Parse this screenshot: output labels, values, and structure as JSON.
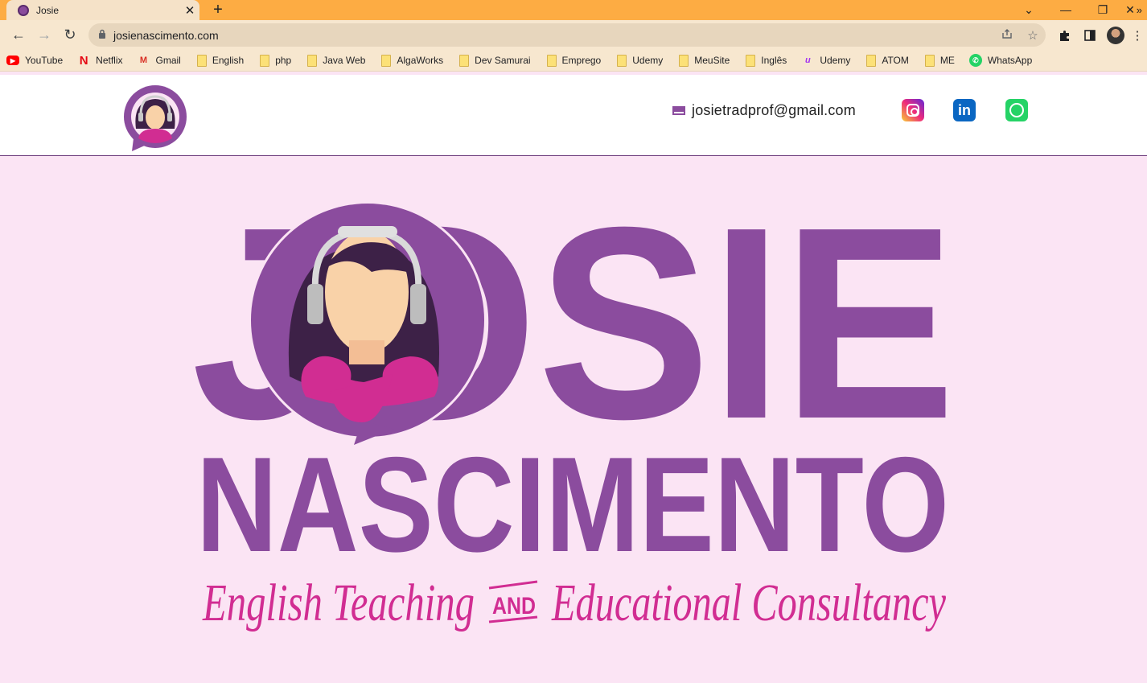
{
  "browser": {
    "tab": {
      "title": "Josie",
      "close_glyph": "✕"
    },
    "new_tab_glyph": "+",
    "window_controls": [
      "⌄",
      "—",
      "❐",
      "✕"
    ],
    "nav": {
      "back": "←",
      "forward": "→",
      "reload": "↻"
    },
    "url": "josienascimento.com",
    "omnibox_icons": [
      "share-icon",
      "star-icon"
    ],
    "toolbar_icons": [
      "extensions-icon",
      "sidepanel-icon",
      "profile-avatar",
      "menu-icon"
    ],
    "bookmarks": [
      {
        "label": "YouTube",
        "icon": "youtube"
      },
      {
        "label": "Netflix",
        "icon": "netflix"
      },
      {
        "label": "Gmail",
        "icon": "gmail"
      },
      {
        "label": "English",
        "icon": "folder"
      },
      {
        "label": "php",
        "icon": "folder"
      },
      {
        "label": "Java Web",
        "icon": "folder"
      },
      {
        "label": "AlgaWorks",
        "icon": "folder"
      },
      {
        "label": "Dev Samurai",
        "icon": "folder"
      },
      {
        "label": "Emprego",
        "icon": "folder"
      },
      {
        "label": "Udemy",
        "icon": "folder"
      },
      {
        "label": "MeuSite",
        "icon": "folder"
      },
      {
        "label": "Inglês",
        "icon": "folder"
      },
      {
        "label": "Udemy",
        "icon": "udemy"
      },
      {
        "label": "ATOM",
        "icon": "folder"
      },
      {
        "label": "ME",
        "icon": "folder"
      },
      {
        "label": "WhatsApp",
        "icon": "whatsapp"
      }
    ],
    "bookmarks_more": "»"
  },
  "site": {
    "email": "josietradprof@gmail.com",
    "social": {
      "instagram": "instagram-icon",
      "linkedin": "in",
      "whatsapp": "whatsapp-icon"
    },
    "hero": {
      "name_first": "JOSIE",
      "name_last": "NASCIMENTO",
      "tagline_left": "English Teaching",
      "tagline_and": "AND",
      "tagline_right": "Educational Consultancy"
    }
  },
  "colors": {
    "brand_purple": "#8b4c9e",
    "brand_pink": "#d12d92",
    "page_bg": "#fbe4f4",
    "tab_strip": "#fdac43"
  }
}
